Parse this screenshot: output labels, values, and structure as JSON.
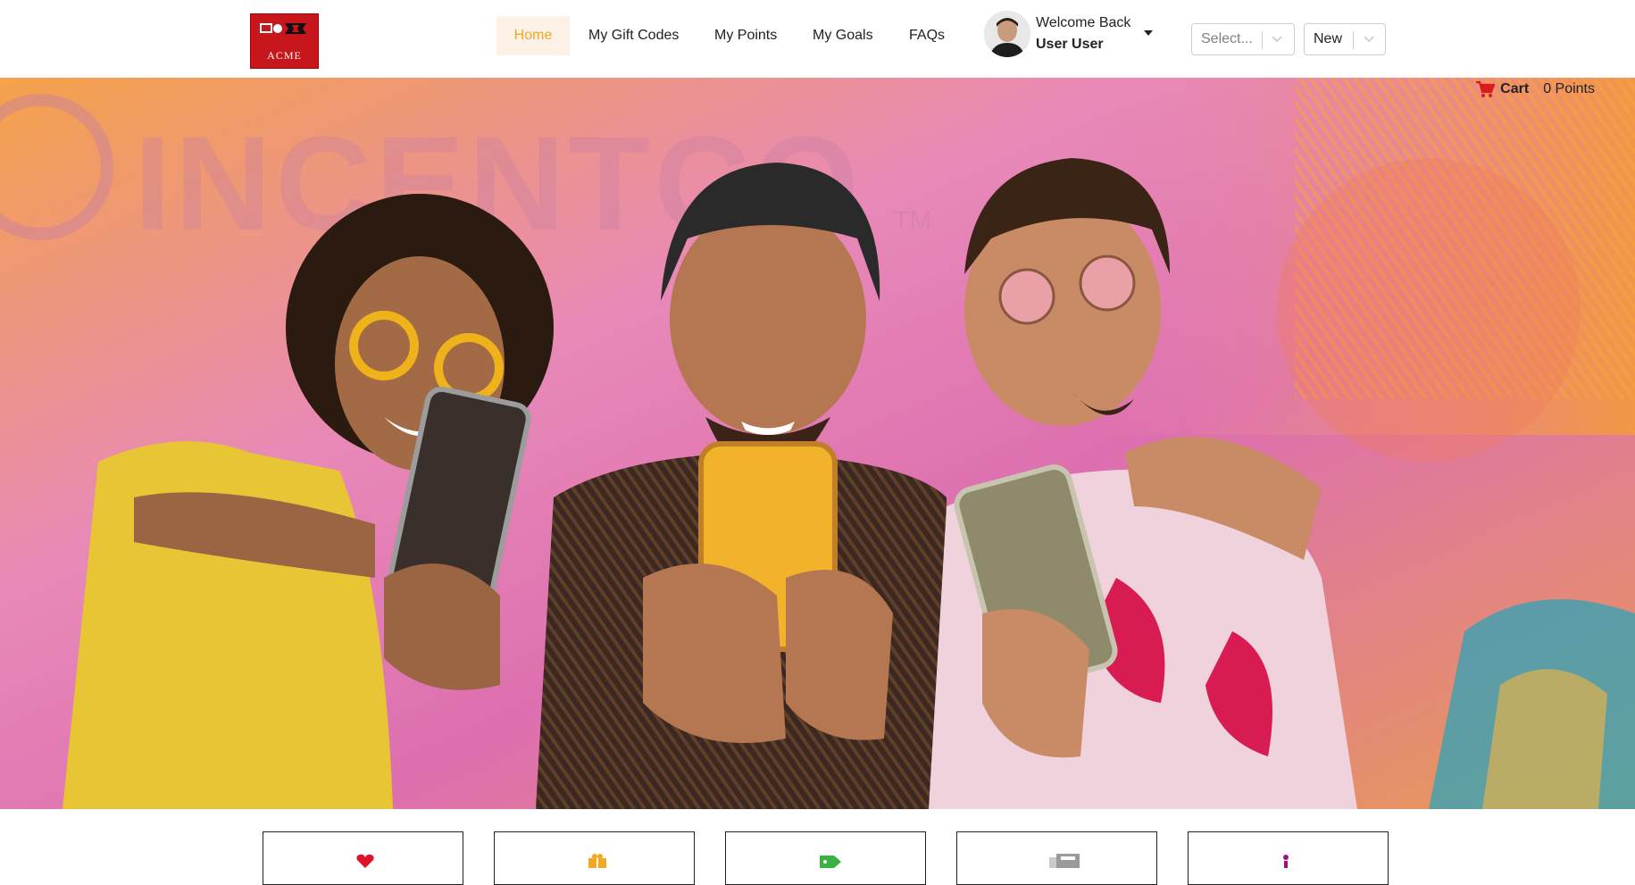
{
  "brand": {
    "logo_text": "ACME"
  },
  "nav": {
    "items": [
      {
        "label": "Home",
        "active": true
      },
      {
        "label": "My Gift Codes",
        "active": false
      },
      {
        "label": "My Points",
        "active": false
      },
      {
        "label": "My Goals",
        "active": false
      },
      {
        "label": "FAQs",
        "active": false
      }
    ]
  },
  "user": {
    "greeting": "Welcome Back",
    "name": "User User"
  },
  "selects": [
    {
      "value": "Select...",
      "is_placeholder": true
    },
    {
      "value": "New",
      "is_placeholder": false
    }
  ],
  "cart": {
    "label": "Cart",
    "points": "0 Points",
    "icon": "cart-icon"
  },
  "hero": {
    "watermark": "INCENTCO",
    "tm": "TM"
  },
  "category_cards": [
    {
      "icon": "heart-icon",
      "color": "#e0112b"
    },
    {
      "icon": "gift-icon",
      "color": "#f5a623"
    },
    {
      "icon": "tag-icon",
      "color": "#3cb043"
    },
    {
      "icon": "document-icon",
      "color": "#888888"
    },
    {
      "icon": "person-icon",
      "color": "#a0117a"
    }
  ],
  "colors": {
    "accent": "#f5a623",
    "active_bg": "#fdf1e6",
    "brand_red": "#c8161d",
    "cart_red": "#d81b1b"
  }
}
